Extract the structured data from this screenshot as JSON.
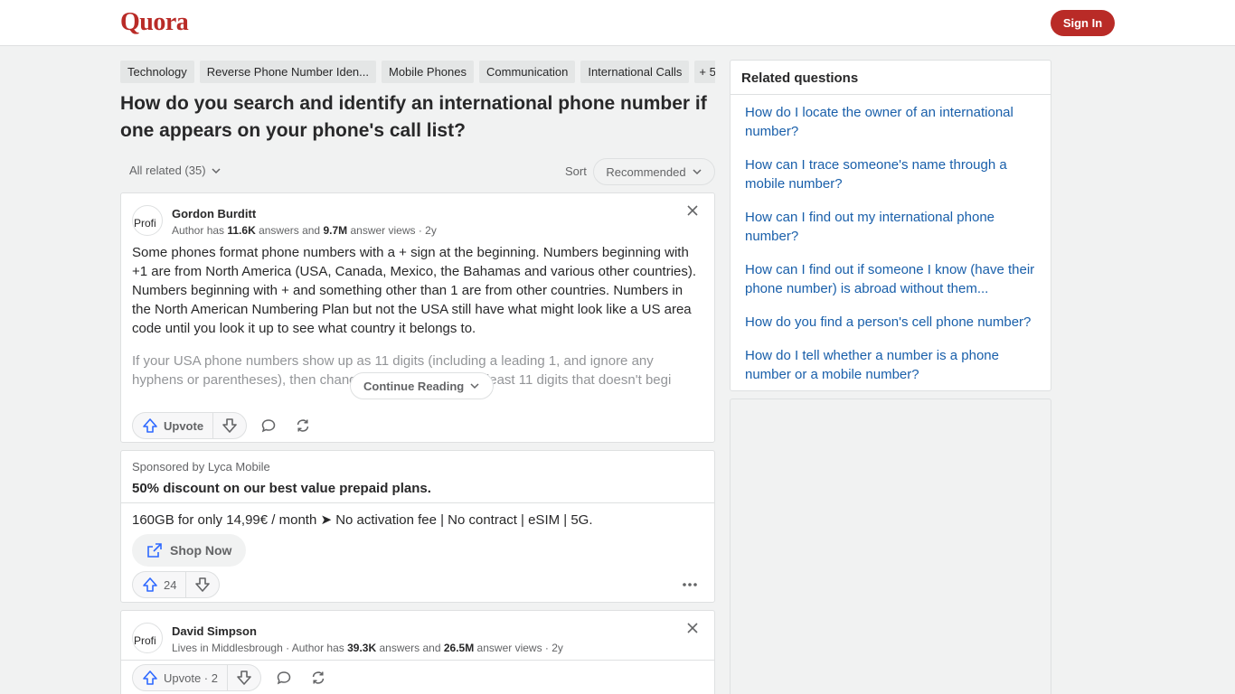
{
  "header": {
    "logo": "Quora",
    "signin_label": "Sign In"
  },
  "tags": [
    "Technology",
    "Reverse Phone Number Iden...",
    "Mobile Phones",
    "Communication",
    "International Calls",
    "+ 5"
  ],
  "question": {
    "title": "How do you search and identify an international phone number if one appears on your phone's call list?"
  },
  "filters": {
    "all_related": "All related (35)",
    "sort_label": "Sort",
    "sort_value": "Recommended"
  },
  "answer1": {
    "avatar_alt": "Profi",
    "author": "Gordon Burditt",
    "meta_prefix": "Author has ",
    "answers_count": "11.6K",
    "meta_mid": " answers and ",
    "views_count": "9.7M",
    "meta_suffix": " answer views · 2y",
    "text": "Some phones format phone numbers with a + sign at the beginning. Numbers beginning with +1 are from North America (USA, Canada, Mexico, the Bahamas and various other countries). Numbers beginning with + and something other than 1 are from other countries. Numbers in the North American Numbering Plan but not the USA still have what might look like a US area code until you look it up to see what country it belongs to.",
    "faded_text": "If your USA phone numbers show up as 11 digits (including a leading 1, and ignore any hyphens or parentheses), then change any number with at least 11 digits that doesn't begi",
    "continue_label": "Continue Reading",
    "upvote_label": "Upvote"
  },
  "ad": {
    "sponsor": "Sponsored by Lyca Mobile",
    "title": "50% discount on our best value prepaid plans.",
    "text": "160GB for only 14,99€ / month ➤ No activation fee | No contract | eSIM | 5G.",
    "shop_label": "Shop Now",
    "upvotes": "24"
  },
  "answer2": {
    "avatar_alt": "Profi",
    "author": "David Simpson",
    "meta_prefix": "Lives in Middlesbrough · Author has ",
    "answers_count": "39.3K",
    "meta_mid": " answers and ",
    "views_count": "26.5M",
    "meta_suffix": " answer views · 2y",
    "upvote_label": "Upvote · 2"
  },
  "related": {
    "heading": "Related questions",
    "items": [
      "How do I locate the owner of an international number?",
      "How can I trace someone's name through a mobile number?",
      "How can I find out my international phone number?",
      "How can I find out if someone I know (have their phone number) is abroad without them...",
      "How do you find a person's cell phone number?",
      "How do I tell whether a number is a phone number or a mobile number?"
    ]
  },
  "colors": {
    "brand": "#b92b27",
    "link": "#195faa",
    "upvote": "#2e69ff"
  }
}
